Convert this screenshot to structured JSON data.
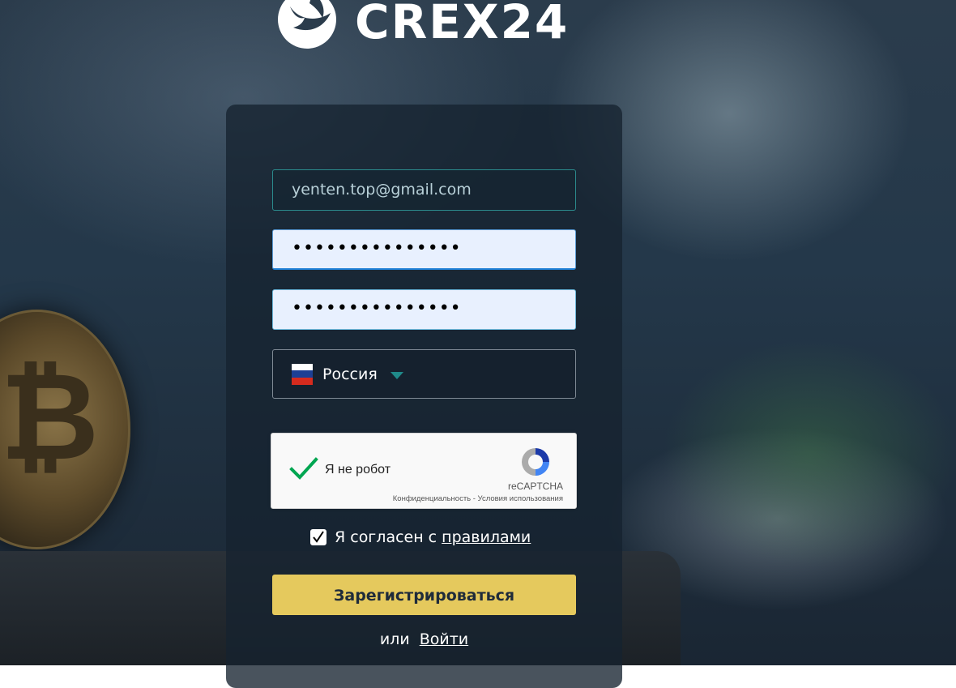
{
  "brand": {
    "name": "CREX24",
    "logo_icon": "phoenix-logo-icon"
  },
  "form": {
    "email_value": "yenten.top@gmail.com",
    "password_value": "•••••••••••••••",
    "password_confirm_value": "•••••••••••••••",
    "country": {
      "name": "Россия",
      "flag_icon": "russia-flag-icon",
      "flag_colors": [
        "#ffffff",
        "#1c3f94",
        "#d52b1e"
      ]
    },
    "captcha": {
      "label": "Я не робот",
      "brand": "reCAPTCHA",
      "links": "Конфиденциальность - Условия использования",
      "checked": true
    },
    "agree": {
      "checked": true,
      "text": "Я согласен с",
      "link_text": "правилами"
    },
    "submit_label": "Зарегистрироваться",
    "alt_text": "или",
    "login_link": "Войти"
  },
  "colors": {
    "accent_button": "#e5c95d",
    "field_border": "#2b8a8c",
    "caret": "#1f8a8a",
    "captcha_check": "#00a651"
  }
}
